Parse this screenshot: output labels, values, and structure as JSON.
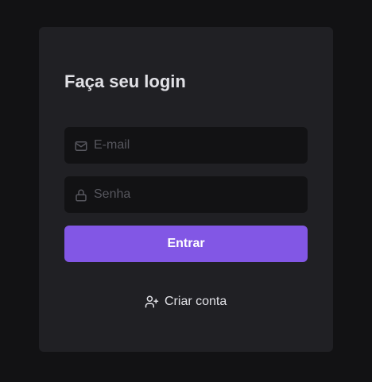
{
  "login": {
    "title": "Faça seu login",
    "email_field": {
      "placeholder": "E-mail",
      "value": "",
      "icon": "mail-icon"
    },
    "password_field": {
      "placeholder": "Senha",
      "value": "",
      "icon": "lock-icon"
    },
    "submit_label": "Entrar",
    "create_account_label": "Criar conta",
    "create_account_icon": "user-plus-icon"
  },
  "colors": {
    "background": "#121214",
    "card": "#202024",
    "input_background": "#121214",
    "accent": "#8257e5",
    "text": "#e1e1e6",
    "placeholder": "#57575e"
  }
}
